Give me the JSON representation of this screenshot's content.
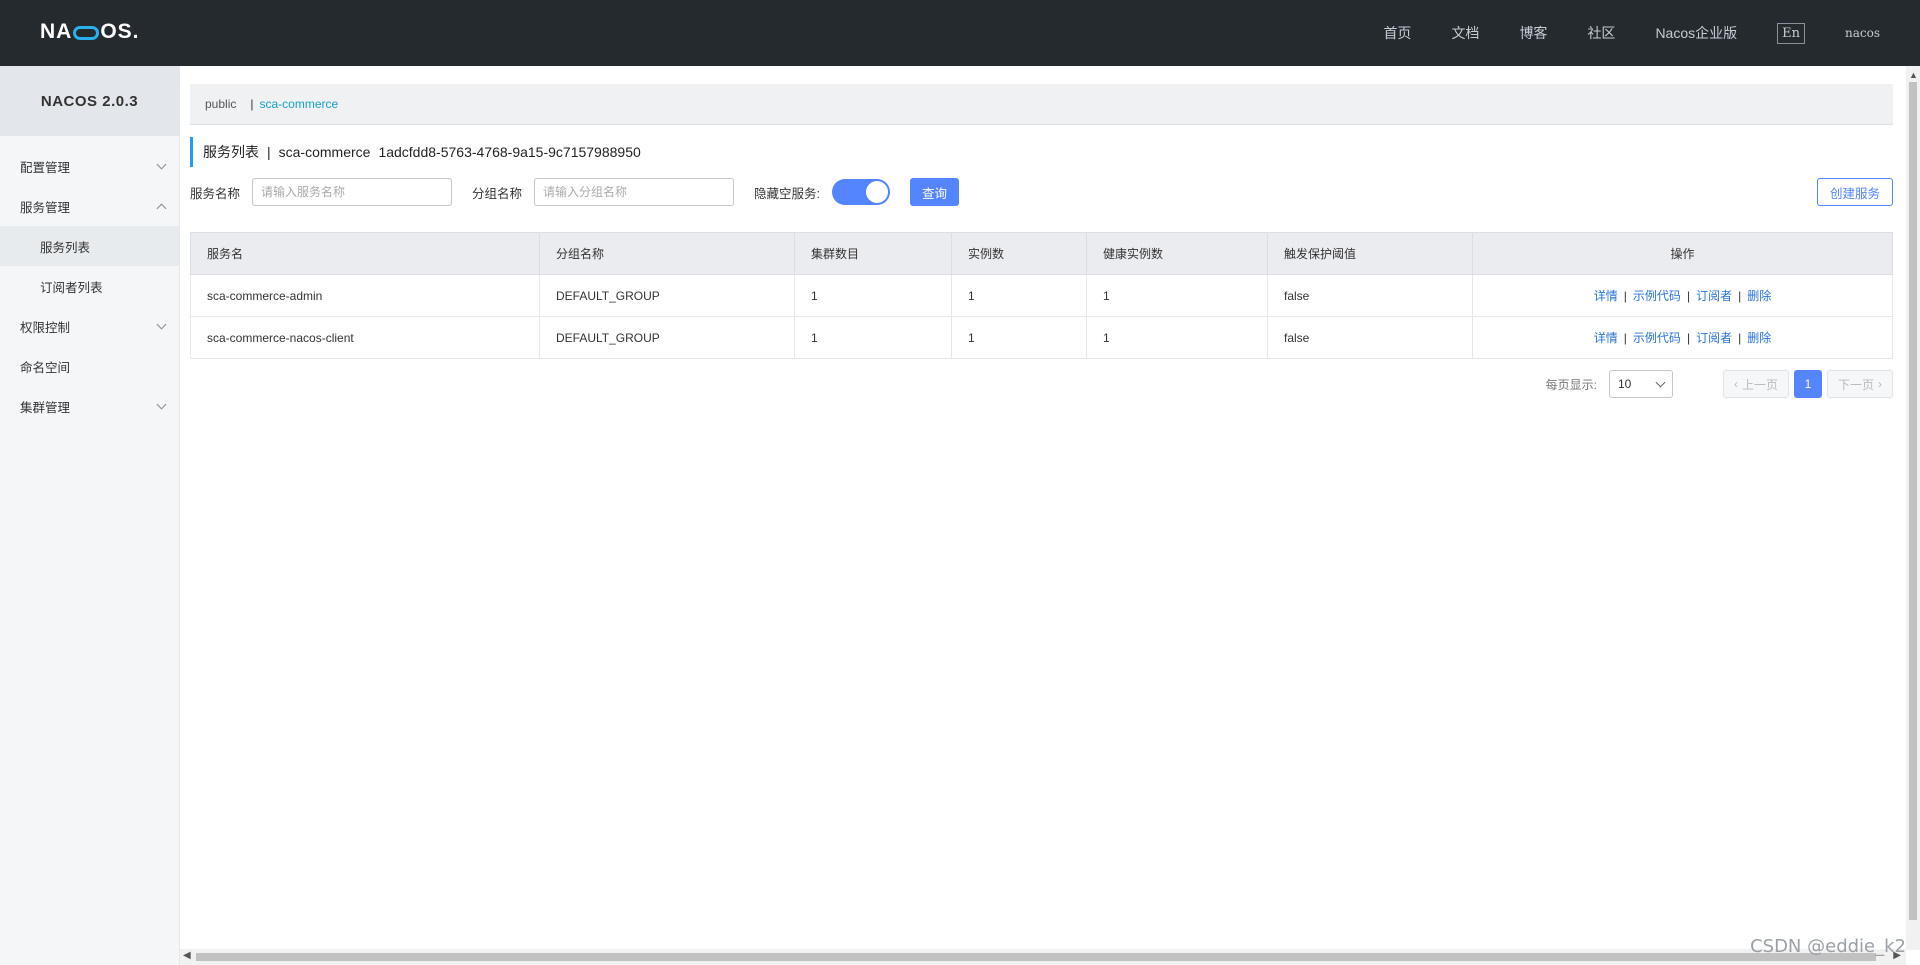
{
  "header": {
    "logo_prefix": "NA",
    "logo_suffix": "OS.",
    "nav": [
      "首页",
      "文档",
      "博客",
      "社区",
      "Nacos企业版"
    ],
    "lang": "En",
    "user": "nacos"
  },
  "sidebar": {
    "title": "NACOS 2.0.3",
    "items": [
      {
        "label": "配置管理"
      },
      {
        "label": "服务管理"
      },
      {
        "label": "服务列表"
      },
      {
        "label": "订阅者列表"
      },
      {
        "label": "权限控制"
      },
      {
        "label": "命名空间"
      },
      {
        "label": "集群管理"
      }
    ]
  },
  "breadcrumb": {
    "ns_public": "public",
    "sep": "|",
    "ns_active": "sca-commerce"
  },
  "page_title": {
    "label": "服务列表",
    "sep": "|",
    "namespace": "sca-commerce",
    "ns_id": "1adcfdd8-5763-4768-9a15-9c7157988950"
  },
  "filters": {
    "service_label": "服务名称",
    "service_placeholder": "请输入服务名称",
    "group_label": "分组名称",
    "group_placeholder": "请输入分组名称",
    "hide_empty_label": "隐藏空服务:",
    "query_button": "查询",
    "create_button": "创建服务"
  },
  "table": {
    "headers": [
      "服务名",
      "分组名称",
      "集群数目",
      "实例数",
      "健康实例数",
      "触发保护阈值",
      "操作"
    ],
    "rows": [
      [
        "sca-commerce-admin",
        "DEFAULT_GROUP",
        "1",
        "1",
        "1",
        "false"
      ],
      [
        "sca-commerce-nacos-client",
        "DEFAULT_GROUP",
        "1",
        "1",
        "1",
        "false"
      ]
    ],
    "actions": [
      "详情",
      "示例代码",
      "订阅者",
      "删除"
    ],
    "action_sep": "|"
  },
  "pagination": {
    "per_page_label": "每页显示:",
    "per_page": "10",
    "prev": "上一页",
    "next": "下一页",
    "current_page": "1"
  },
  "watermark": "CSDN @eddie_k2"
}
